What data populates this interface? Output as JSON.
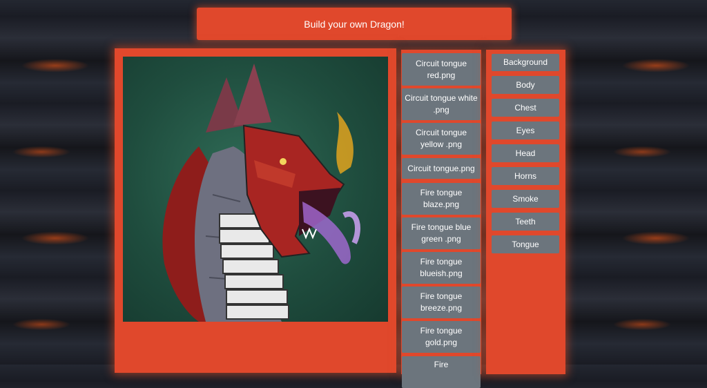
{
  "header": {
    "title": "Build your own Dragon!"
  },
  "files": [
    "Circuit tongue red.png",
    "Circuit tongue white .png",
    "Circuit tongue yellow .png",
    "Circuit tongue.png",
    "Fire tongue blaze.png",
    "Fire tongue blue green .png",
    "Fire tongue blueish.png",
    "Fire tongue breeze.png",
    "Fire tongue gold.png",
    "Fire"
  ],
  "categories": [
    "Background",
    "Body",
    "Chest",
    "Eyes",
    "Head",
    "Horns",
    "Smoke",
    "Teeth",
    "Tongue"
  ],
  "colors": {
    "accent": "#e0482c",
    "button": "#6c757d",
    "preview_bg": "#1f4d3e"
  }
}
